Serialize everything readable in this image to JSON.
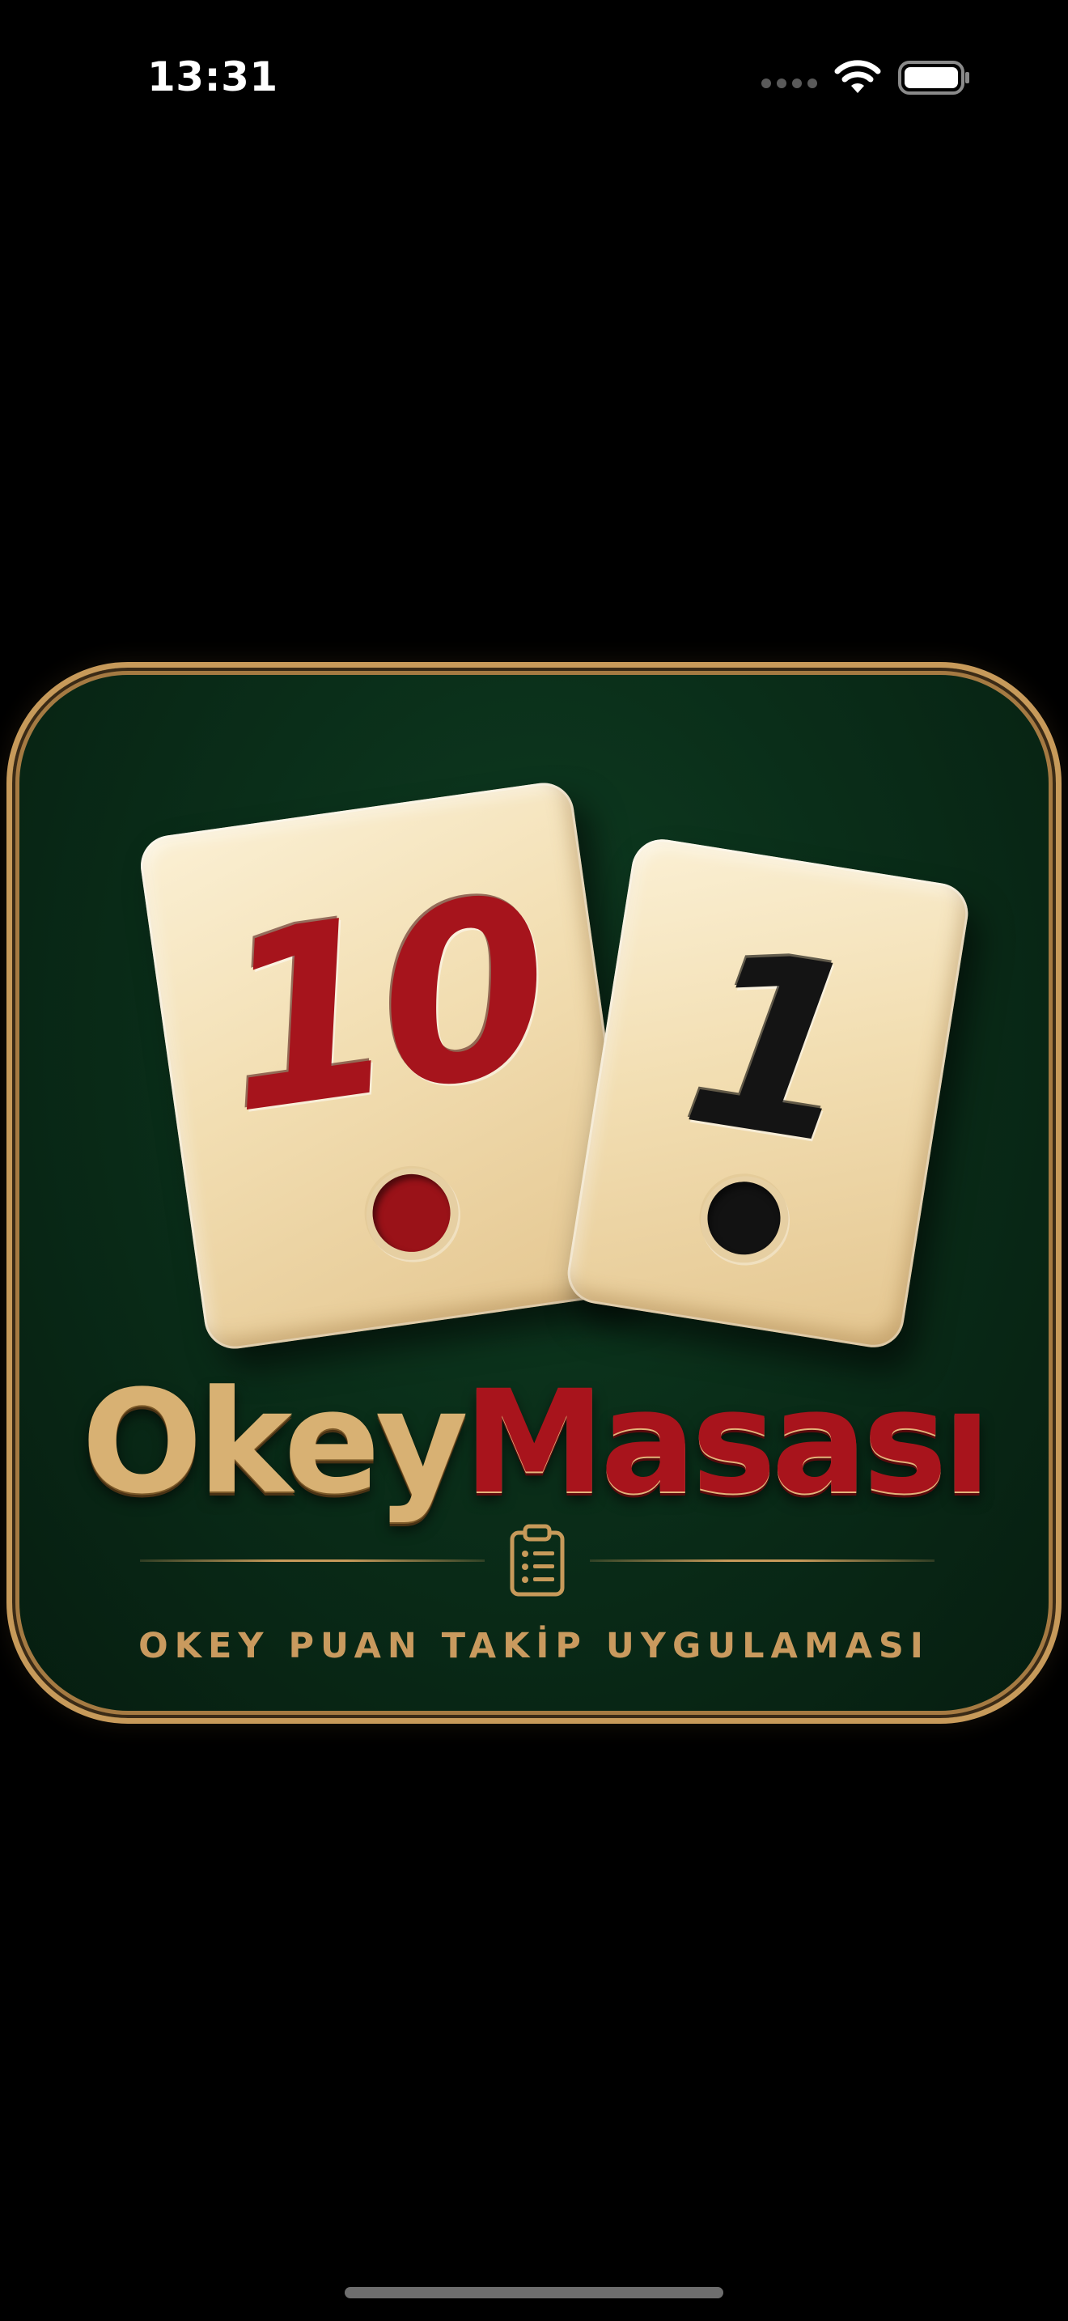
{
  "status_bar": {
    "time": "13:31"
  },
  "logo": {
    "tile_left_number": "10",
    "tile_right_number": "1",
    "brand_part1": "Okey",
    "brand_part2": "Masası",
    "tagline": "OKEY PUAN TAKİP UYGULAMASI",
    "icon": "clipboard-list-icon"
  },
  "colors": {
    "background": "#000000",
    "felt_green": "#0a2e19",
    "gold": "#c79a5a",
    "tile_cream": "#f2deb2",
    "red": "#a8141c",
    "black": "#141414"
  }
}
